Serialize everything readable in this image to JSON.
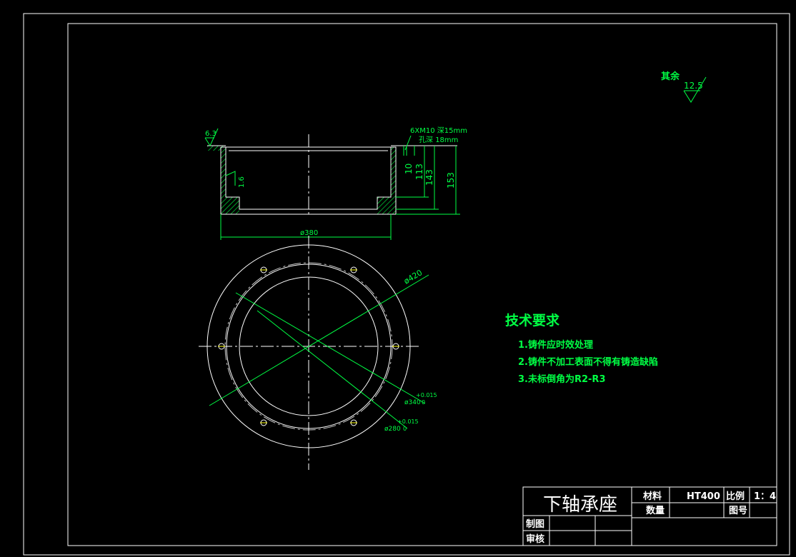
{
  "drawing": {
    "title": "下轴承座",
    "roughness_general": {
      "label": "其余",
      "value": "12.5"
    },
    "roughness_top": "6.3",
    "roughness_inner": "1.6",
    "hole_note": [
      "6XM10",
      "深15mm",
      "孔深",
      "18mm"
    ],
    "dims_vertical": [
      "10",
      "113",
      "143",
      "153"
    ],
    "dim_width": "ø380",
    "dim_outer_circle": "ø420",
    "dim_bore_1": {
      "value": "ø340",
      "tol_upper": "+0.015",
      "tol_lower": "0"
    },
    "dim_bore_2": {
      "value": "ø280",
      "tol_upper": "+0.015",
      "tol_lower": "0"
    },
    "tech_req": {
      "heading": "技术要求",
      "items": [
        "1.铸件应时效处理",
        "2.铸件不加工表面不得有铸造缺陷",
        "3.未标倒角为R2-R3"
      ]
    },
    "title_block": {
      "material_label": "材料",
      "material_value": "HT400",
      "scale_label": "比例",
      "scale_value": "1：4",
      "quantity_label": "数量",
      "drawing_no_label": "图号",
      "drawn_label": "制图",
      "checked_label": "审核"
    }
  },
  "colors": {
    "background": "#000000",
    "line": "#ffffff",
    "annotation": "#00ff44",
    "marker": "#ffff00"
  }
}
